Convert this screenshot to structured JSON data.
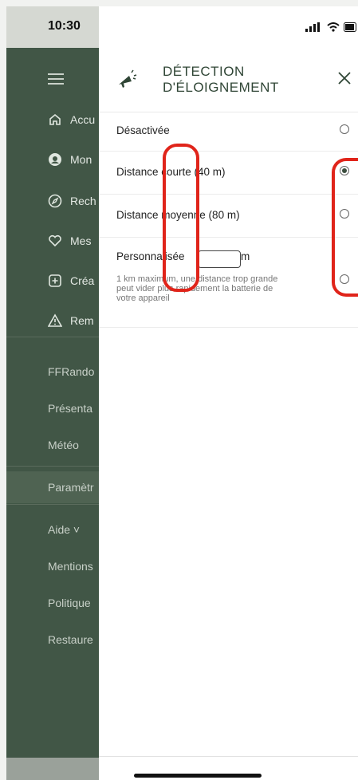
{
  "status": {
    "time": "10:30"
  },
  "drawer": {
    "items": [
      {
        "label": "Accu",
        "icon": "home-icon"
      },
      {
        "label": "Mon",
        "icon": "avatar-icon"
      },
      {
        "label": "Rech",
        "icon": "compass-icon"
      },
      {
        "label": "Mes",
        "icon": "heart-icon"
      },
      {
        "label": "Créa",
        "icon": "plus-square-icon"
      },
      {
        "label": "Rem",
        "icon": "warning-icon"
      }
    ],
    "links": [
      "FFRando",
      "Présenta",
      "Météo",
      "Paramètr",
      "Aide ˅",
      "Mentions",
      "Politique",
      "Restaure"
    ]
  },
  "panel": {
    "title_line1": "DÉTECTION",
    "title_line2": "D'ÉLOIGNEMENT",
    "options": [
      {
        "label": "Désactivée",
        "checked": false
      },
      {
        "label": "Distance courte (40 m)",
        "checked": true
      },
      {
        "label": "Distance moyenne (80 m)",
        "checked": false
      }
    ],
    "custom": {
      "label": "Personnalisée",
      "value": "",
      "unit": "m",
      "note": "1 km maximum, une distance trop grande peut vider plus rapidement la batterie de votre appareil",
      "checked": false
    }
  },
  "colors": {
    "drawer_bg": "#415646",
    "accent": "#2f4535",
    "annotation": "#e0241a"
  }
}
